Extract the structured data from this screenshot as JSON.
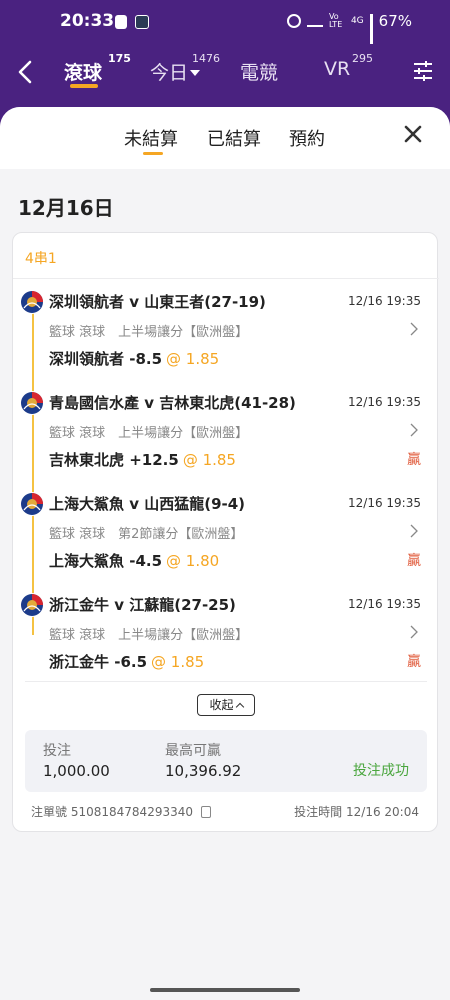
{
  "status_bar": {
    "time": "20:33",
    "network_label": "Vo LTE",
    "signal": "4G",
    "battery": "67%"
  },
  "top_nav": {
    "tabs": [
      {
        "label": "滾球",
        "count": "175",
        "active": true
      },
      {
        "label": "今日",
        "count": "1476",
        "active": false
      },
      {
        "label": "電競",
        "count": "",
        "active": false
      },
      {
        "label": "VR",
        "count": "295",
        "active": false
      }
    ],
    "accent_color": "#f5a623",
    "header_color": "#4a2280"
  },
  "sheet": {
    "tabs": [
      {
        "label": "未結算",
        "active": true
      },
      {
        "label": "已結算",
        "active": false
      },
      {
        "label": "預約",
        "active": false
      }
    ],
    "date_heading": "12月16日"
  },
  "bet": {
    "type": "4串1",
    "legs": [
      {
        "match": "深圳領航者 v 山東王者(27-19)",
        "time": "12/16 19:35",
        "market": "籃球 滾球　上半場讓分【歐洲盤】",
        "pick": "深圳領航者 -8.5",
        "odds": "@ 1.85",
        "result": ""
      },
      {
        "match": "青島國信水產 v 吉林東北虎(41-28)",
        "time": "12/16 19:35",
        "market": "籃球 滾球　上半場讓分【歐洲盤】",
        "pick": "吉林東北虎 +12.5",
        "odds": "@ 1.85",
        "result": "贏"
      },
      {
        "match": "上海大鯊魚 v 山西猛龍(9-4)",
        "time": "12/16 19:35",
        "market": "籃球 滾球　第2節讓分【歐洲盤】",
        "pick": "上海大鯊魚 -4.5",
        "odds": "@ 1.80",
        "result": "贏"
      },
      {
        "match": "浙江金牛 v 江蘇龍(27-25)",
        "time": "12/16 19:35",
        "market": "籃球 滾球　上半場讓分【歐洲盤】",
        "pick": "浙江金牛 -6.5",
        "odds": "@ 1.85",
        "result": "贏"
      }
    ],
    "collapse_label": "收起",
    "stake_label": "投注",
    "stake_value": "1,000.00",
    "max_win_label": "最高可贏",
    "max_win_value": "10,396.92",
    "status": "投注成功",
    "ticket_label": "注單號",
    "ticket_number": "5108184784293340",
    "bet_time_label": "投注時間",
    "bet_time_value": "12/16 20:04",
    "win_color": "#e05a3a",
    "success_color": "#4aa63e"
  }
}
